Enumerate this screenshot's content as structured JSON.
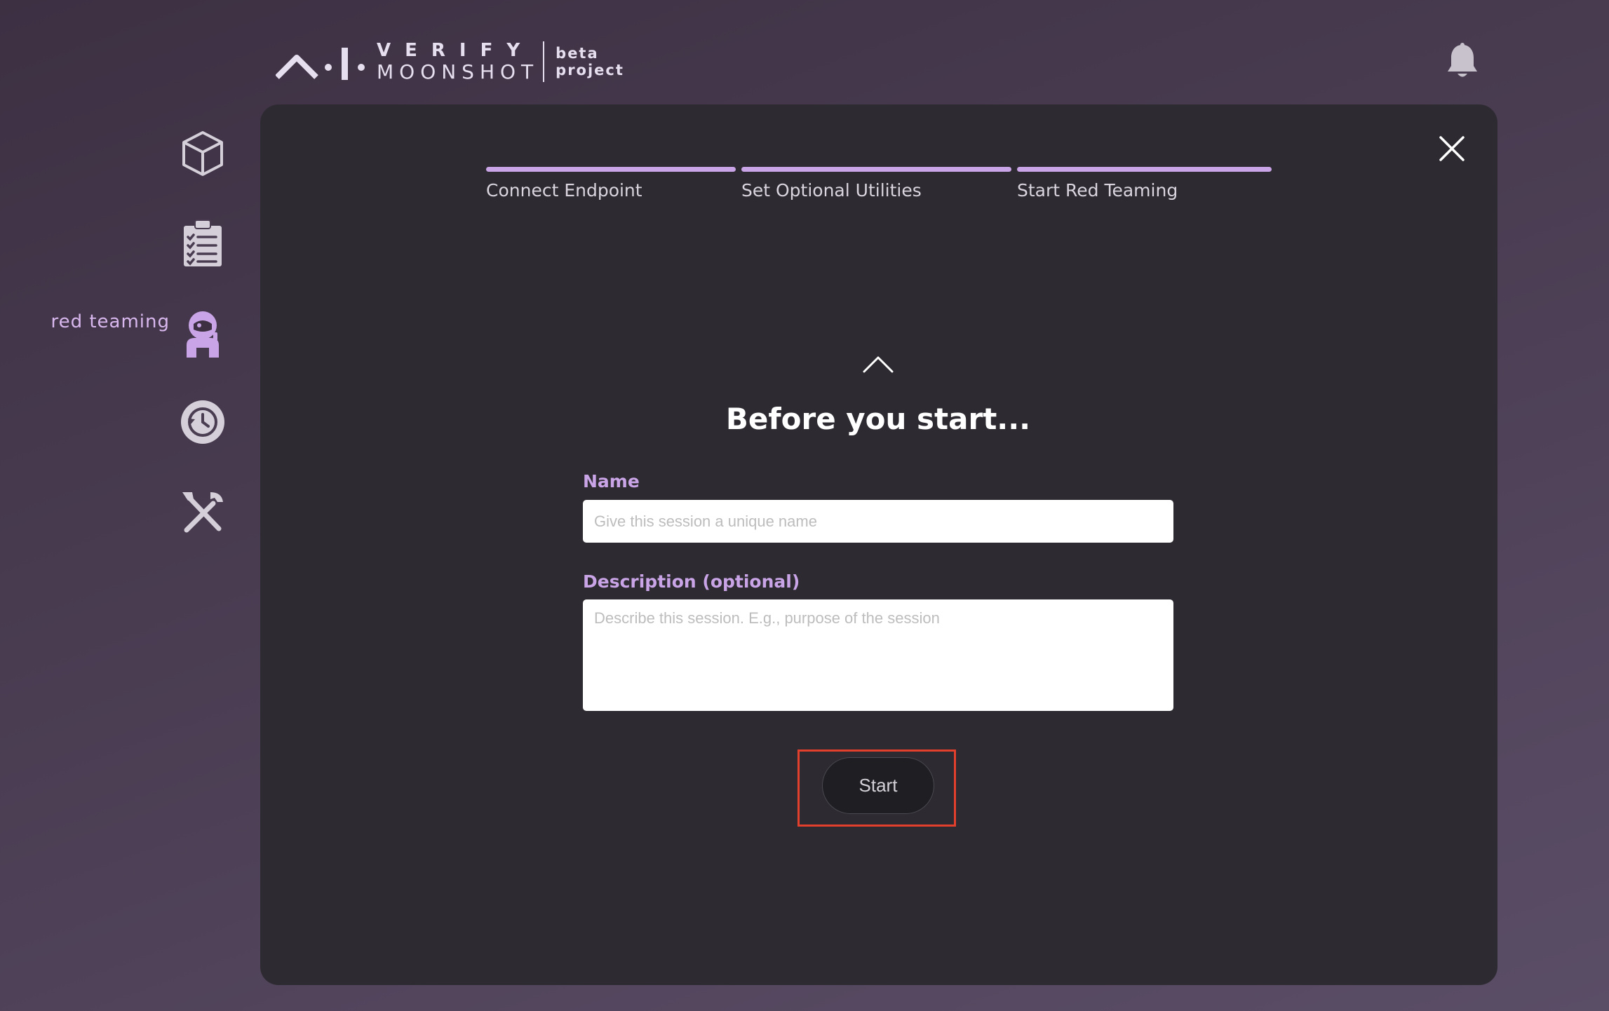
{
  "header": {
    "logo_verify": "VERIFY",
    "logo_moonshot": "MOONSHOT",
    "logo_beta": "beta",
    "logo_project": "project",
    "notification_icon": "bell-icon"
  },
  "sidebar": {
    "items": [
      {
        "icon": "cube-icon",
        "label": ""
      },
      {
        "icon": "clipboard-checklist-icon",
        "label": ""
      },
      {
        "icon": "astronaut-icon",
        "label": "red teaming",
        "active": true
      },
      {
        "icon": "history-clock-icon",
        "label": ""
      },
      {
        "icon": "tools-icon",
        "label": ""
      }
    ],
    "active_label": "red teaming"
  },
  "steps": [
    {
      "label": "Connect Endpoint",
      "complete": true
    },
    {
      "label": "Set Optional Utilities",
      "complete": true
    },
    {
      "label": "Start Red Teaming",
      "complete": true
    }
  ],
  "form": {
    "title": "Before you start...",
    "name_label": "Name",
    "name_placeholder": "Give this session a unique name",
    "name_value": "",
    "description_label": "Description (optional)",
    "description_placeholder": "Describe this session. E.g., purpose of the session",
    "description_value": "",
    "start_label": "Start"
  },
  "colors": {
    "accent": "#c9a4e6",
    "panel": "#2d2b31",
    "highlight": "#e2402c"
  }
}
